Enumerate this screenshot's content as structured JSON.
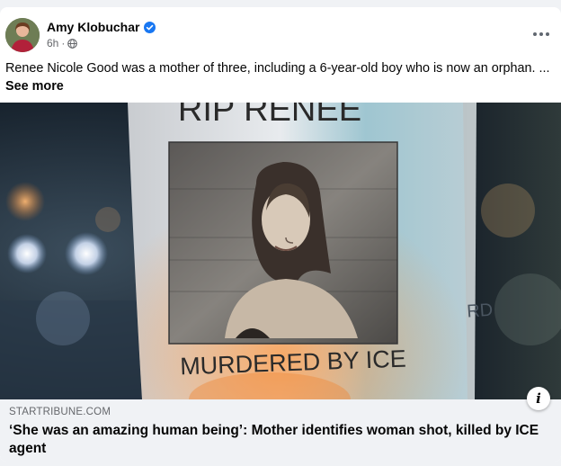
{
  "post": {
    "author": "Amy Klobuchar",
    "timestamp": "6h",
    "meta_separator": "·",
    "audience_icon": "globe-icon",
    "verified_icon": "verified-badge-icon",
    "text": "Renee Nicole Good was a mother of three, including a 6-year-old boy who is now an orphan. ...",
    "see_more_label": "See more"
  },
  "photo": {
    "sign_top_text": "RIP RENEE",
    "sign_bottom_text": "MURDERED BY ICE",
    "side_sign_text": "MURD"
  },
  "link_preview": {
    "domain": "STARTRIBUNE.COM",
    "title": "‘She was an amazing human being’: Mother identifies woman shot, killed by ICE agent",
    "info_label": "i"
  },
  "colors": {
    "verified_blue": "#1877f2",
    "secondary_text": "#65676b",
    "link_bar_bg": "#f0f2f5"
  }
}
